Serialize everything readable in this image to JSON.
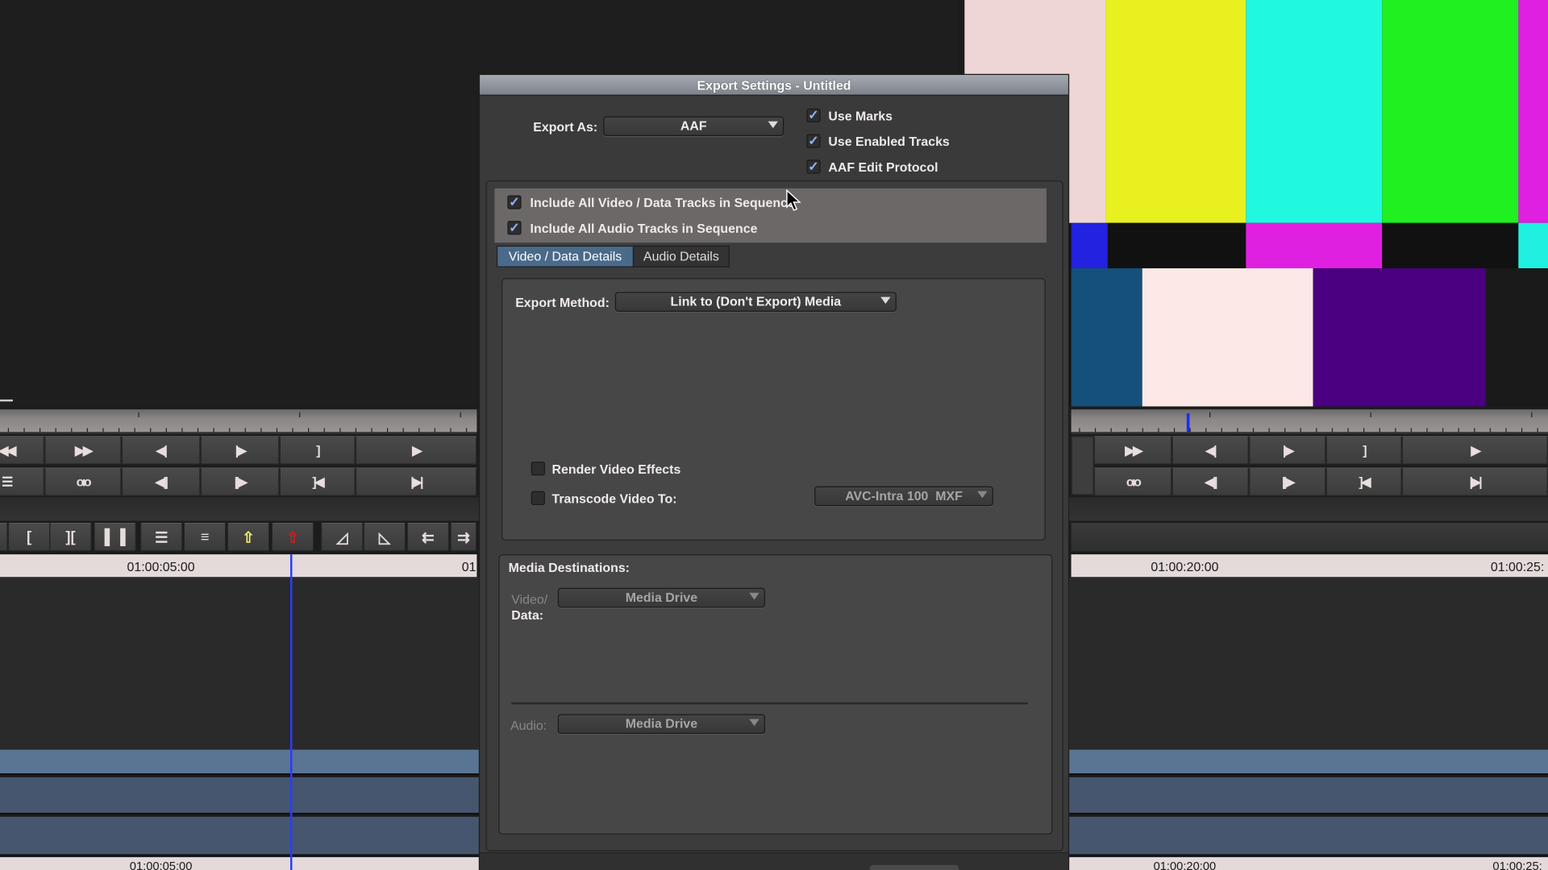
{
  "colors": {
    "accent": "#4a6a8a",
    "playhead": "#2a3cff",
    "track_light": "#5a7494",
    "track_dark": "#46566e"
  },
  "colorbars": [
    "#eed6d6",
    "#e8f020",
    "#20f8e0",
    "#20f020",
    "#e020e0",
    "#2222e0",
    "#111111",
    "#e020e0",
    "#111111",
    "#20f0e0",
    "#14507a",
    "#fde8e8",
    "#4a0080",
    "#1a1a1a"
  ],
  "source_monitor": {
    "row1": [
      {
        "icon": "rewind-icon",
        "glyph": "◀◀"
      },
      {
        "icon": "fast-forward-icon",
        "glyph": "▶▶"
      },
      {
        "icon": "step-back-icon",
        "glyph": "◀|"
      },
      {
        "icon": "step-forward-icon",
        "glyph": "|▶"
      },
      {
        "icon": "mark-out-icon",
        "glyph": "]"
      },
      {
        "icon": "play-icon",
        "glyph": "▶"
      }
    ],
    "row2": [
      {
        "icon": "clip-list-icon",
        "glyph": "☰"
      },
      {
        "icon": "tape-icon",
        "glyph": "oıo"
      },
      {
        "icon": "step-back-10-icon",
        "glyph": "◀||"
      },
      {
        "icon": "step-forward-10-icon",
        "glyph": "||▶"
      },
      {
        "icon": "go-to-out-icon",
        "glyph": "]◀"
      },
      {
        "icon": "go-to-end-icon",
        "glyph": "|▶|"
      }
    ]
  },
  "record_monitor": {
    "row1": [
      {
        "icon": "fast-forward-icon",
        "glyph": "▶▶"
      },
      {
        "icon": "step-back-icon",
        "glyph": "◀|"
      },
      {
        "icon": "step-forward-icon",
        "glyph": "|▶"
      },
      {
        "icon": "mark-out-icon",
        "glyph": "]"
      },
      {
        "icon": "play-icon",
        "glyph": "▶"
      }
    ],
    "row2": [
      {
        "icon": "tape-icon",
        "glyph": "oıo"
      },
      {
        "icon": "step-back-10-icon",
        "glyph": "◀||"
      },
      {
        "icon": "step-forward-10-icon",
        "glyph": "||▶"
      },
      {
        "icon": "go-to-out-icon",
        "glyph": "]◀"
      },
      {
        "icon": "go-to-end-icon",
        "glyph": "|▶|"
      }
    ]
  },
  "timeline_toolbar": [
    {
      "icon": "mark-in-icon",
      "glyph": "["
    },
    {
      "icon": "mark-clip-icon",
      "glyph": "]["
    },
    {
      "icon": "clear-marks-icon",
      "glyph": "▌▐"
    },
    {
      "icon": "lift-overwrite-icon",
      "glyph": "☰"
    },
    {
      "icon": "segment-icon",
      "glyph": "≡"
    },
    {
      "icon": "lift-icon",
      "glyph": "⇧"
    },
    {
      "icon": "extract-icon",
      "glyph": "⇧"
    },
    {
      "icon": "trim-left-icon",
      "glyph": "◿"
    },
    {
      "icon": "trim-right-icon",
      "glyph": "◺"
    },
    {
      "icon": "splice-left-icon",
      "glyph": "⇇"
    },
    {
      "icon": "splice-right-icon",
      "glyph": "⇉"
    }
  ],
  "timeline": {
    "ruler_left": [
      "01:00:05:00",
      "01"
    ],
    "ruler_right": [
      "01:00:20:00",
      "01:00:25:"
    ]
  },
  "dialog": {
    "title": "Export Settings - Untitled",
    "export_as_label": "Export As:",
    "export_as_value": "AAF",
    "options": [
      {
        "label": "Use Marks",
        "checked": true
      },
      {
        "label": "Use Enabled Tracks",
        "checked": true
      },
      {
        "label": "AAF Edit Protocol",
        "checked": true
      }
    ],
    "include": [
      {
        "label": "Include All Video / Data Tracks in Sequence",
        "checked": true
      },
      {
        "label": "Include All Audio Tracks in Sequence",
        "checked": true
      }
    ],
    "tabs": [
      {
        "label": "Video / Data Details",
        "selected": true
      },
      {
        "label": "Audio Details",
        "selected": false
      }
    ],
    "export_method_label": "Export Method:",
    "export_method_value": "Link to (Don't Export) Media",
    "render_effects": {
      "label": "Render Video Effects",
      "checked": false
    },
    "transcode": {
      "label": "Transcode Video To:",
      "checked": false,
      "value": "AVC-Intra 100  MXF"
    },
    "media_destinations": {
      "title": "Media Destinations:",
      "video_label_1": "Video/",
      "video_label_2": "Data:",
      "video_value": "Media Drive",
      "audio_label": "Audio:",
      "audio_value": "Media Drive"
    }
  }
}
